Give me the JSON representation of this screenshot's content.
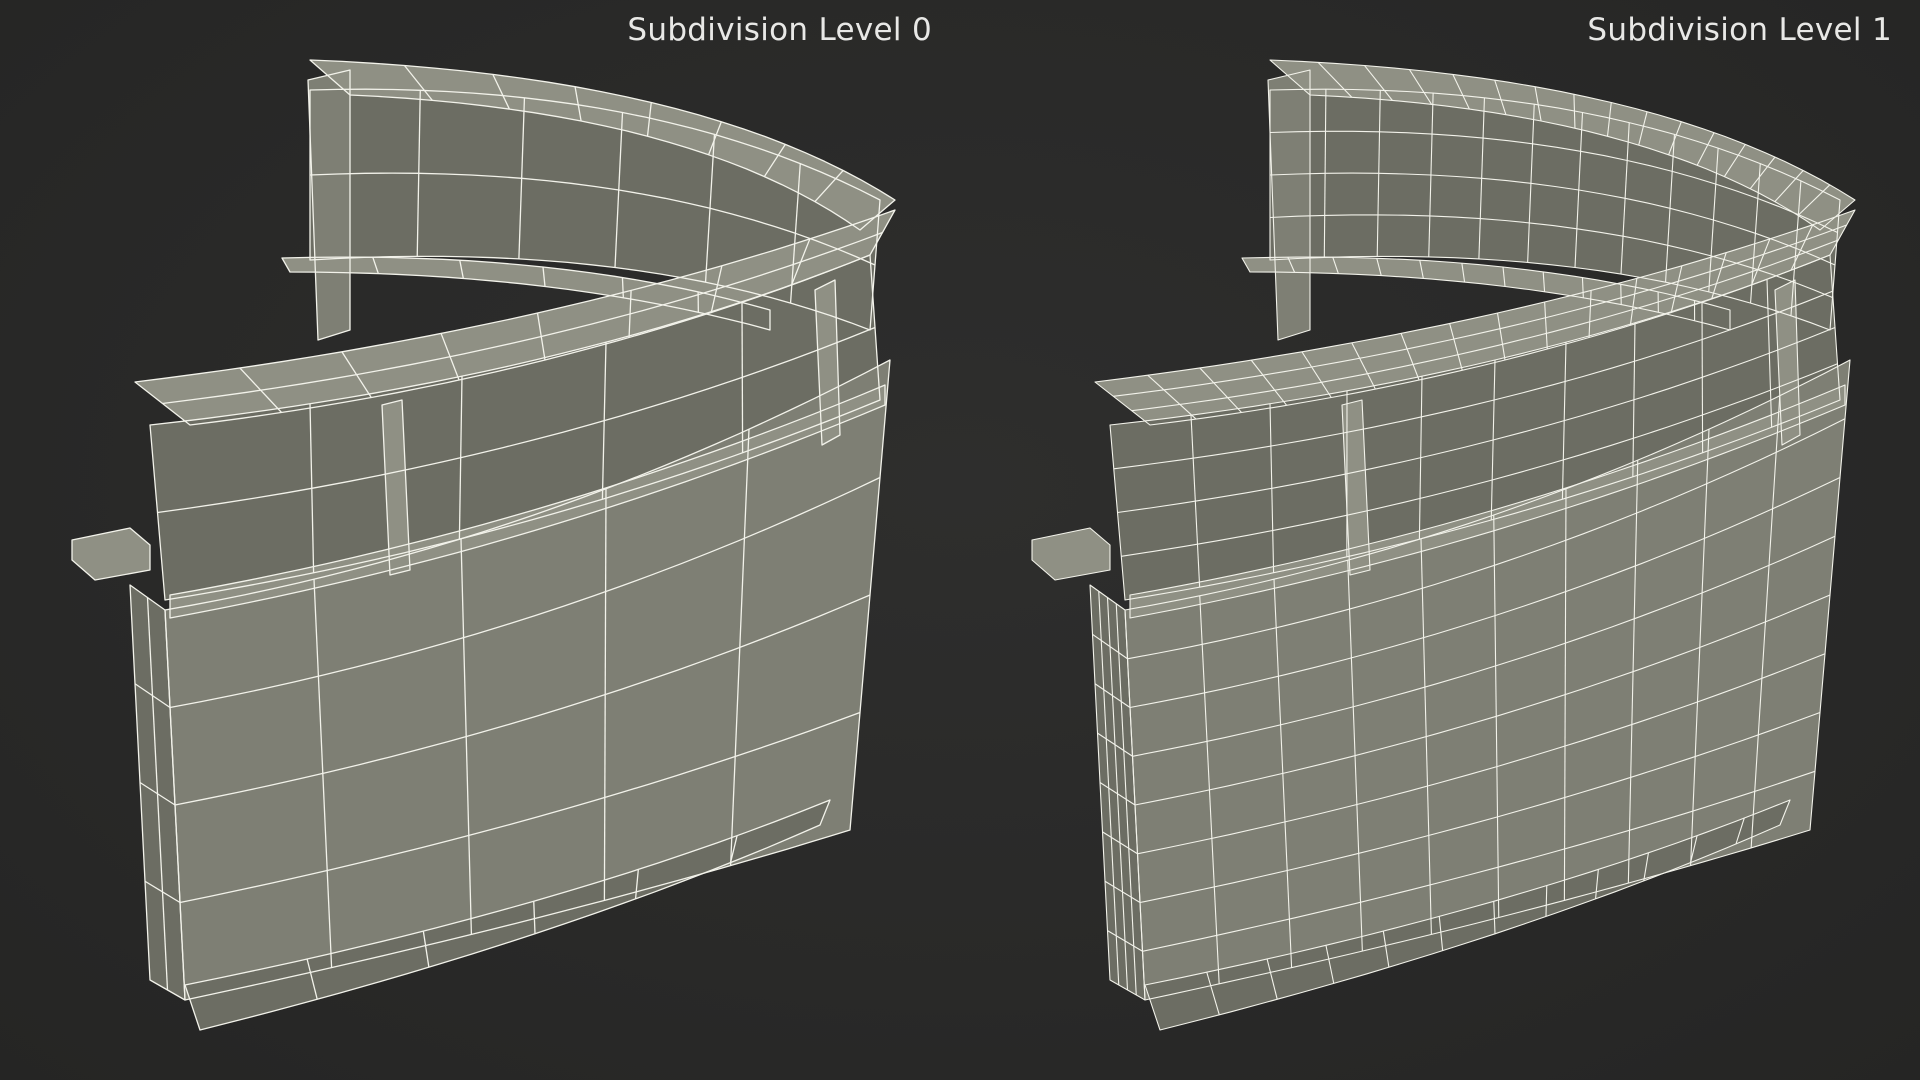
{
  "panels": [
    {
      "label": "Subdivision Level 0",
      "subdivision": 0,
      "density": 1
    },
    {
      "label": "Subdivision Level 1",
      "subdivision": 1,
      "density": 2
    }
  ],
  "colors": {
    "background": "#2a2a29",
    "surface": "#7e7f74",
    "surface_dark": "#6c6d63",
    "surface_light": "#8f9084",
    "wire": "#f2f2ea",
    "label": "#e8e8e6"
  }
}
